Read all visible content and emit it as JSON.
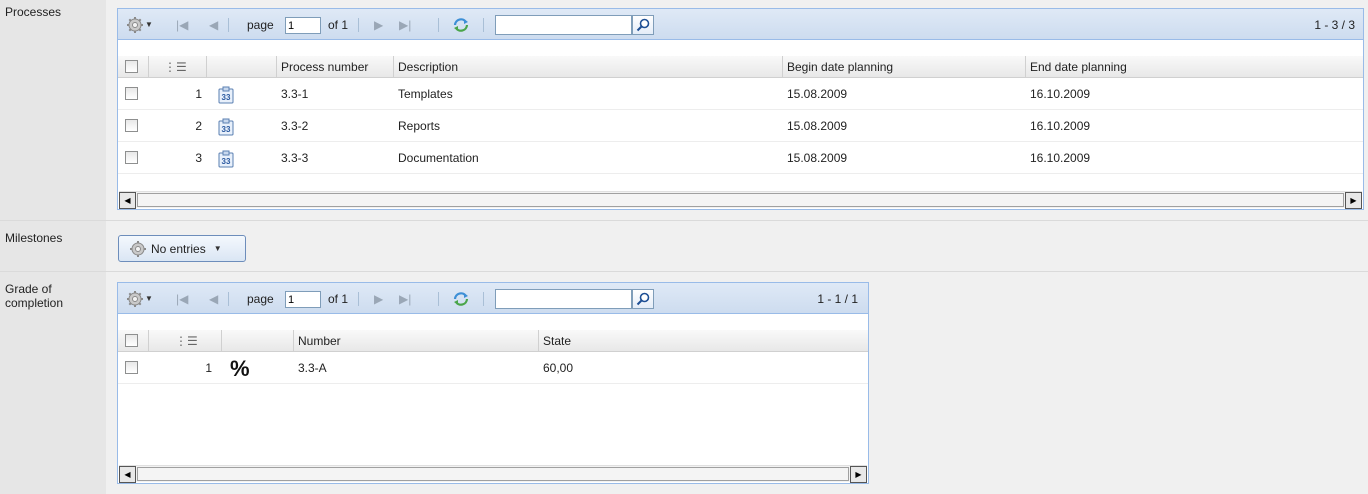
{
  "sections": {
    "processes_label": "Processes",
    "milestones_label": "Milestones",
    "grade_label_1": "Grade of",
    "grade_label_2": "completion"
  },
  "icons": {
    "settings": "gear-icon",
    "first": "first-page-icon",
    "prev": "prev-page-icon",
    "next": "next-page-icon",
    "last": "last-page-icon",
    "refresh": "refresh-icon",
    "search": "search-icon",
    "process": "process-icon",
    "percent": "%"
  },
  "processes": {
    "toolbar": {
      "page_label": "page",
      "page_value": "1",
      "of_label": "of 1",
      "search_value": "",
      "count": "1 - 3 / 3"
    },
    "columns": [
      "Process number",
      "Description",
      "Begin date planning",
      "End date planning"
    ],
    "rows": [
      {
        "index": "1",
        "number": "3.3-1",
        "description": "Templates",
        "begin": "15.08.2009",
        "end": "16.10.2009"
      },
      {
        "index": "2",
        "number": "3.3-2",
        "description": "Reports",
        "begin": "15.08.2009",
        "end": "16.10.2009"
      },
      {
        "index": "3",
        "number": "3.3-3",
        "description": "Documentation",
        "begin": "15.08.2009",
        "end": "16.10.2009"
      }
    ]
  },
  "milestones": {
    "button_label": "No entries"
  },
  "grade": {
    "toolbar": {
      "page_label": "page",
      "page_value": "1",
      "of_label": "of 1",
      "search_value": "",
      "count": "1 - 1 / 1"
    },
    "columns": [
      "Number",
      "State"
    ],
    "rows": [
      {
        "index": "1",
        "icon": "%",
        "number": "3.3-A",
        "state": "60,00"
      }
    ]
  },
  "colors": {
    "toolbar_top": "#dfe9f6",
    "toolbar_border": "#99bbe8",
    "label_bg": "#e6e6e6",
    "content_bg": "#f0f0f0"
  }
}
